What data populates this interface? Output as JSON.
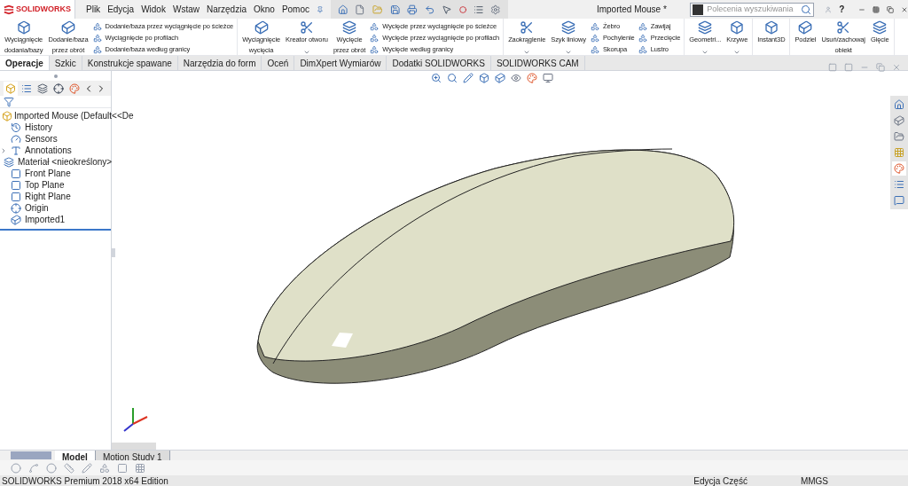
{
  "title_bar": {
    "logo": "SOLIDWORKS",
    "menu": [
      "Plik",
      "Edycja",
      "Widok",
      "Wstaw",
      "Narzędzia",
      "Okno",
      "Pomoc"
    ],
    "title": "Imported Mouse *",
    "search": {
      "placeholder": "Polecenia wyszukiwania"
    },
    "help": "?"
  },
  "ribbon": [
    [
      {
        "kind": "large",
        "lines": [
          "Wyciągnięcie",
          "dodania/bazy"
        ]
      },
      {
        "kind": "large",
        "lines": [
          "Dodanie/baza",
          "przez obrót"
        ]
      },
      {
        "kind": "column",
        "items": [
          "Dodanie/baza przez wyciągnięcie po ścieżce",
          "Wyciągnięcie po profilach",
          "Dodanie/baza według granicy"
        ]
      }
    ],
    [
      {
        "kind": "large",
        "lines": [
          "Wyciągnięcie",
          "wycięcia"
        ]
      },
      {
        "kind": "menu",
        "lines": [
          "Kreator otworu"
        ]
      },
      {
        "kind": "large",
        "lines": [
          "Wycięcie",
          "przez obrót"
        ]
      },
      {
        "kind": "column",
        "items": [
          "Wycięcie przez wyciągnięcie po ścieżce",
          "Wycięcie przez wyciągnięcie po profilach",
          "Wycięcie według granicy"
        ]
      }
    ],
    [
      {
        "kind": "menu",
        "lines": [
          "Zaokrąglenie"
        ]
      },
      {
        "kind": "menu",
        "lines": [
          "Szyk liniowy"
        ]
      },
      {
        "kind": "column",
        "items": [
          "Żebro",
          "Pochylenie",
          "Skorupa"
        ]
      },
      {
        "kind": "column",
        "items": [
          "Zawijaj",
          "Przecięcie",
          "Lustro"
        ]
      }
    ],
    [
      {
        "kind": "menu",
        "lines": [
          "Geometri..."
        ]
      },
      {
        "kind": "menu",
        "lines": [
          "Krzywe"
        ]
      }
    ],
    [
      {
        "kind": "large",
        "lines": [
          "Instant3D"
        ]
      }
    ],
    [
      {
        "kind": "large",
        "lines": [
          "Podziel"
        ]
      },
      {
        "kind": "large",
        "lines": [
          "Usuń/zachowaj",
          "obiekt"
        ]
      },
      {
        "kind": "large",
        "lines": [
          "Gięcie"
        ]
      }
    ]
  ],
  "tabs": [
    {
      "label": "Operacje",
      "selected": true
    },
    {
      "label": "Szkic",
      "selected": false
    },
    {
      "label": "Konstrukcje spawane",
      "selected": false
    },
    {
      "label": "Narzędzia do form",
      "selected": false
    },
    {
      "label": "Oceń",
      "selected": false
    },
    {
      "label": "DimXpert Wymiarów",
      "selected": false
    },
    {
      "label": "Dodatki SOLIDWORKS",
      "selected": false
    },
    {
      "label": "SOLIDWORKS CAM",
      "selected": false
    }
  ],
  "feature_tree": {
    "root": "Imported Mouse  (Default<<De",
    "items": [
      {
        "kind": "history",
        "label": "History",
        "expandable": false
      },
      {
        "kind": "sensors",
        "label": "Sensors",
        "expandable": false
      },
      {
        "kind": "annotations",
        "label": "Annotations",
        "expandable": true
      },
      {
        "kind": "material",
        "label": "Materiał <nieokreślony>",
        "expandable": false
      },
      {
        "kind": "plane",
        "label": "Front Plane",
        "expandable": false
      },
      {
        "kind": "plane",
        "label": "Top Plane",
        "expandable": false
      },
      {
        "kind": "plane",
        "label": "Right Plane",
        "expandable": false
      },
      {
        "kind": "origin",
        "label": "Origin",
        "expandable": false
      },
      {
        "kind": "body",
        "label": "Imported1",
        "expandable": false
      }
    ]
  },
  "bottom_tabs": [
    {
      "label": "Model",
      "selected": true
    },
    {
      "label": "Motion Study 1",
      "selected": false
    }
  ],
  "status_bar": {
    "edition": "SOLIDWORKS Premium 2018 x64 Edition",
    "mode": "Edycja Część",
    "units": "MMGS"
  }
}
